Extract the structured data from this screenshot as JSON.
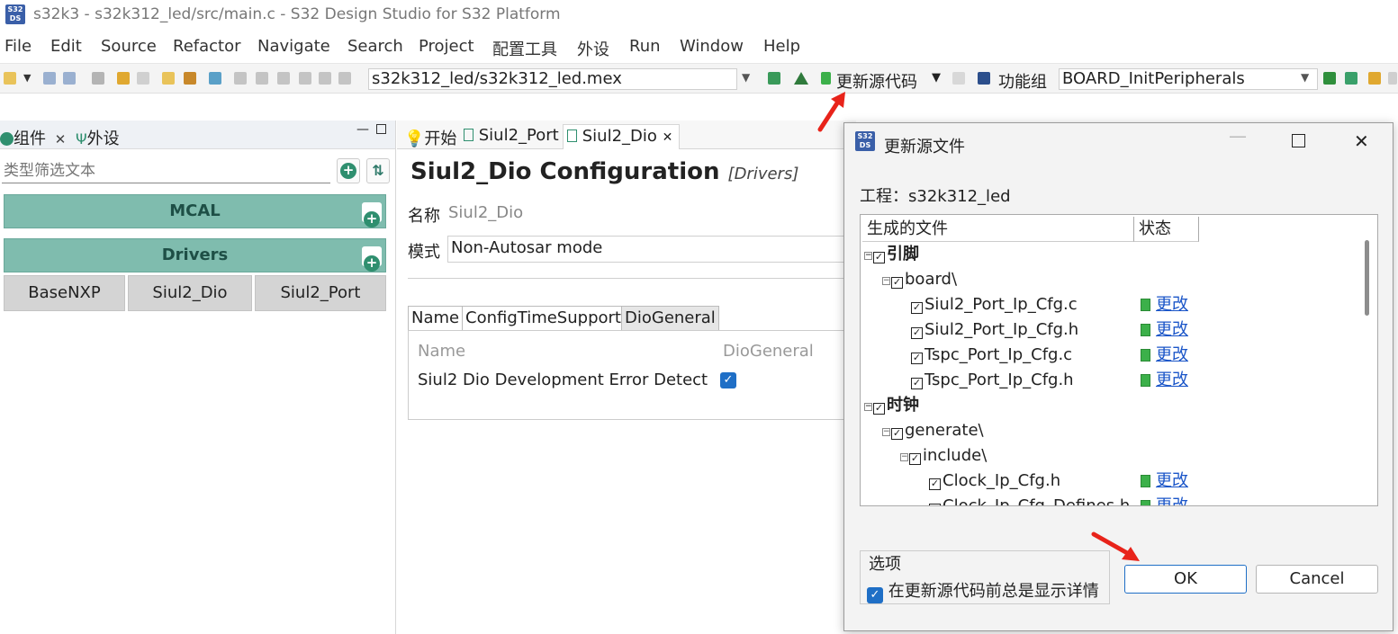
{
  "window": {
    "logo_text": "S32\nDS",
    "title": "s32k3 - s32k312_led/src/main.c - S32 Design Studio for S32 Platform"
  },
  "menu": [
    "File",
    "Edit",
    "Source",
    "Refactor",
    "Navigate",
    "Search",
    "Project",
    "配置工具",
    "外设",
    "Run",
    "Window",
    "Help"
  ],
  "toolbar": {
    "project_combo": "s32k312_led/s32k312_led.mex",
    "update_code_label": "更新源代码",
    "function_group_label": "功能组",
    "function_group_value": "BOARD_InitPeripherals"
  },
  "left_panel": {
    "tabs": [
      "组件",
      "外设"
    ],
    "filter_placeholder": "类型筛选文本",
    "groups": [
      "MCAL",
      "Drivers"
    ],
    "components": [
      "BaseNXP",
      "Siul2_Dio",
      "Siul2_Port"
    ]
  },
  "editor": {
    "tabs": [
      "开始",
      "Siul2_Port",
      "Siul2_Dio"
    ],
    "title": "Siul2_Dio Configuration",
    "title_sub": "[Drivers]",
    "name_label": "名称",
    "name_value": "Siul2_Dio",
    "mode_label": "模式",
    "mode_value": "Non-Autosar mode",
    "config_tabs": [
      "Name",
      "ConfigTimeSupport",
      "DioGeneral"
    ],
    "table_headers": [
      "Name",
      "DioGeneral"
    ],
    "table_row": "Siul2 Dio Development Error Detect"
  },
  "dialog": {
    "title": "更新源文件",
    "project_label": "工程：s32k312_led",
    "col_files": "生成的文件",
    "col_status": "状态",
    "tree": [
      {
        "label": "引脚",
        "bold": true,
        "status": ""
      },
      {
        "label": "board\\",
        "bold": false,
        "status": ""
      },
      {
        "label": "Siul2_Port_Ip_Cfg.c",
        "bold": false,
        "status": "更改"
      },
      {
        "label": "Siul2_Port_Ip_Cfg.h",
        "bold": false,
        "status": "更改"
      },
      {
        "label": "Tspc_Port_Ip_Cfg.c",
        "bold": false,
        "status": "更改"
      },
      {
        "label": "Tspc_Port_Ip_Cfg.h",
        "bold": false,
        "status": "更改"
      },
      {
        "label": "时钟",
        "bold": true,
        "status": ""
      },
      {
        "label": "generate\\",
        "bold": false,
        "status": ""
      },
      {
        "label": "include\\",
        "bold": false,
        "status": ""
      },
      {
        "label": "Clock_Ip_Cfg.h",
        "bold": false,
        "status": "更改"
      },
      {
        "label": "Clock_Ip_Cfg_Defines.h",
        "bold": false,
        "status": "更改"
      }
    ],
    "options_label": "选项",
    "options_checkbox": "在更新源代码前总是显示详情",
    "ok": "OK",
    "cancel": "Cancel"
  },
  "colors": {
    "group_bar": "#7fbcae",
    "link": "#1a55c8",
    "checkbox_blue": "#1f6fc6",
    "annotation_arrow": "#e8231a"
  }
}
